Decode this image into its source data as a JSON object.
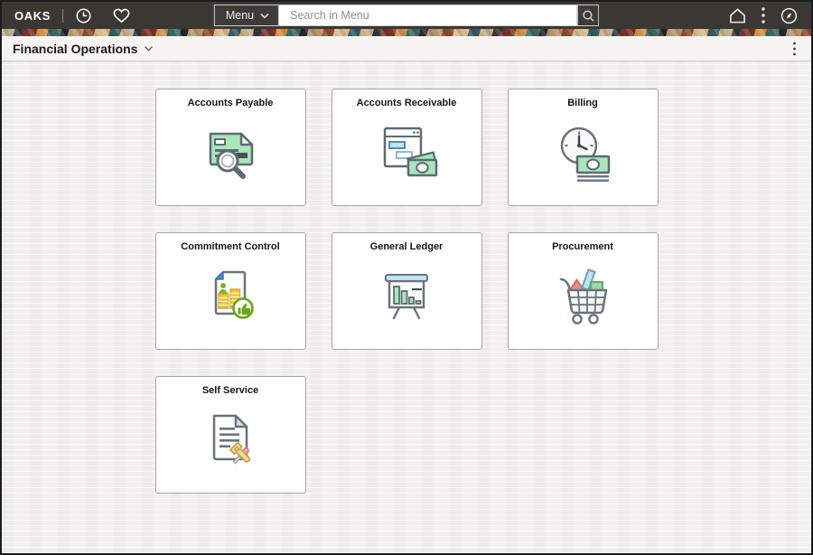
{
  "topbar": {
    "logo": "OAKS",
    "menu_button_label": "Menu",
    "search_placeholder": "Search in Menu",
    "icons": [
      "clock-icon",
      "heart-icon",
      "search-icon",
      "home-icon",
      "kebab-menu-icon",
      "compass-icon"
    ]
  },
  "header": {
    "title": "Financial Operations",
    "icons": [
      "chevron-down-icon",
      "kebab-menu-icon"
    ]
  },
  "tiles": [
    {
      "label": "Accounts Payable",
      "icon": "accounts-payable-icon"
    },
    {
      "label": "Accounts Receivable",
      "icon": "accounts-receivable-icon"
    },
    {
      "label": "Billing",
      "icon": "billing-icon"
    },
    {
      "label": "Commitment Control",
      "icon": "commitment-control-icon"
    },
    {
      "label": "General Ledger",
      "icon": "general-ledger-icon"
    },
    {
      "label": "Procurement",
      "icon": "procurement-icon"
    },
    {
      "label": "Self Service",
      "icon": "self-service-icon"
    }
  ],
  "colors": {
    "topbar_bg": "#3b3733",
    "subheader_bg": "#f5f4f2",
    "content_bg": "#f1f0ee",
    "tile_border": "#a6a6a6",
    "icon_green": "#a9e5bd",
    "icon_blue": "#bfe3f2",
    "icon_yellow": "#eac435",
    "icon_red": "#e89191",
    "icon_outline": "#5f6a73",
    "thumb_green": "#69a41e"
  }
}
